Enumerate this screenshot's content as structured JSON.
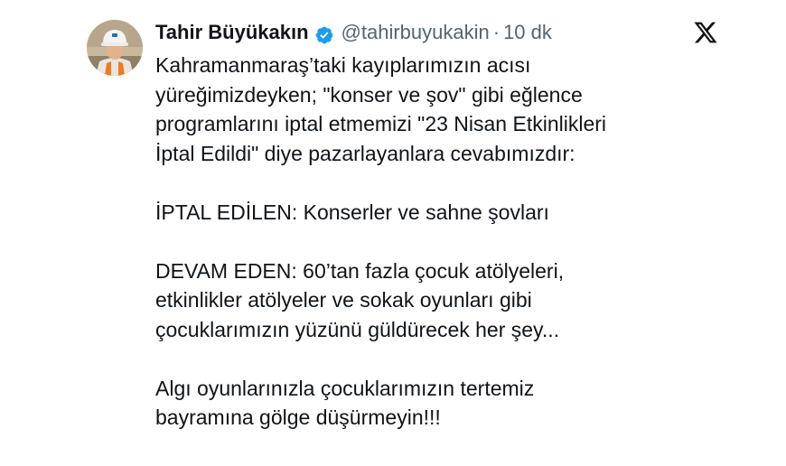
{
  "tweet": {
    "author_name": "Tahir Büyükakın",
    "handle": "@tahirbuyukakin",
    "separator": "·",
    "time": "10 dk",
    "paragraphs": [
      "Kahramanmaraş’taki kayıplarımızın acısı\nyüreğimizdeyken; \"konser ve şov\" gibi eğlence\nprogramlarını iptal etmemizi \"23 Nisan Etkinlikleri\nİptal Edildi\" diye pazarlayanlara cevabımızdır:",
      "İPTAL EDİLEN: Konserler ve sahne şovları",
      "DEVAM EDEN: 60’tan fazla çocuk atölyeleri,\netkinlikler atölyeler ve sokak oyunları gibi\nçocuklarımızın yüzünü güldürecek her şey...",
      "Algı oyunlarınızla çocuklarımızın tertemiz\nbayramına gölge düşürmeyin!!!"
    ]
  },
  "icons": {
    "verified": "verified-badge-icon",
    "logo": "x-logo-icon",
    "avatar": "avatar-photo"
  },
  "colors": {
    "text": "#0f1419",
    "secondary": "#536471",
    "verified": "#1d9bf0"
  }
}
